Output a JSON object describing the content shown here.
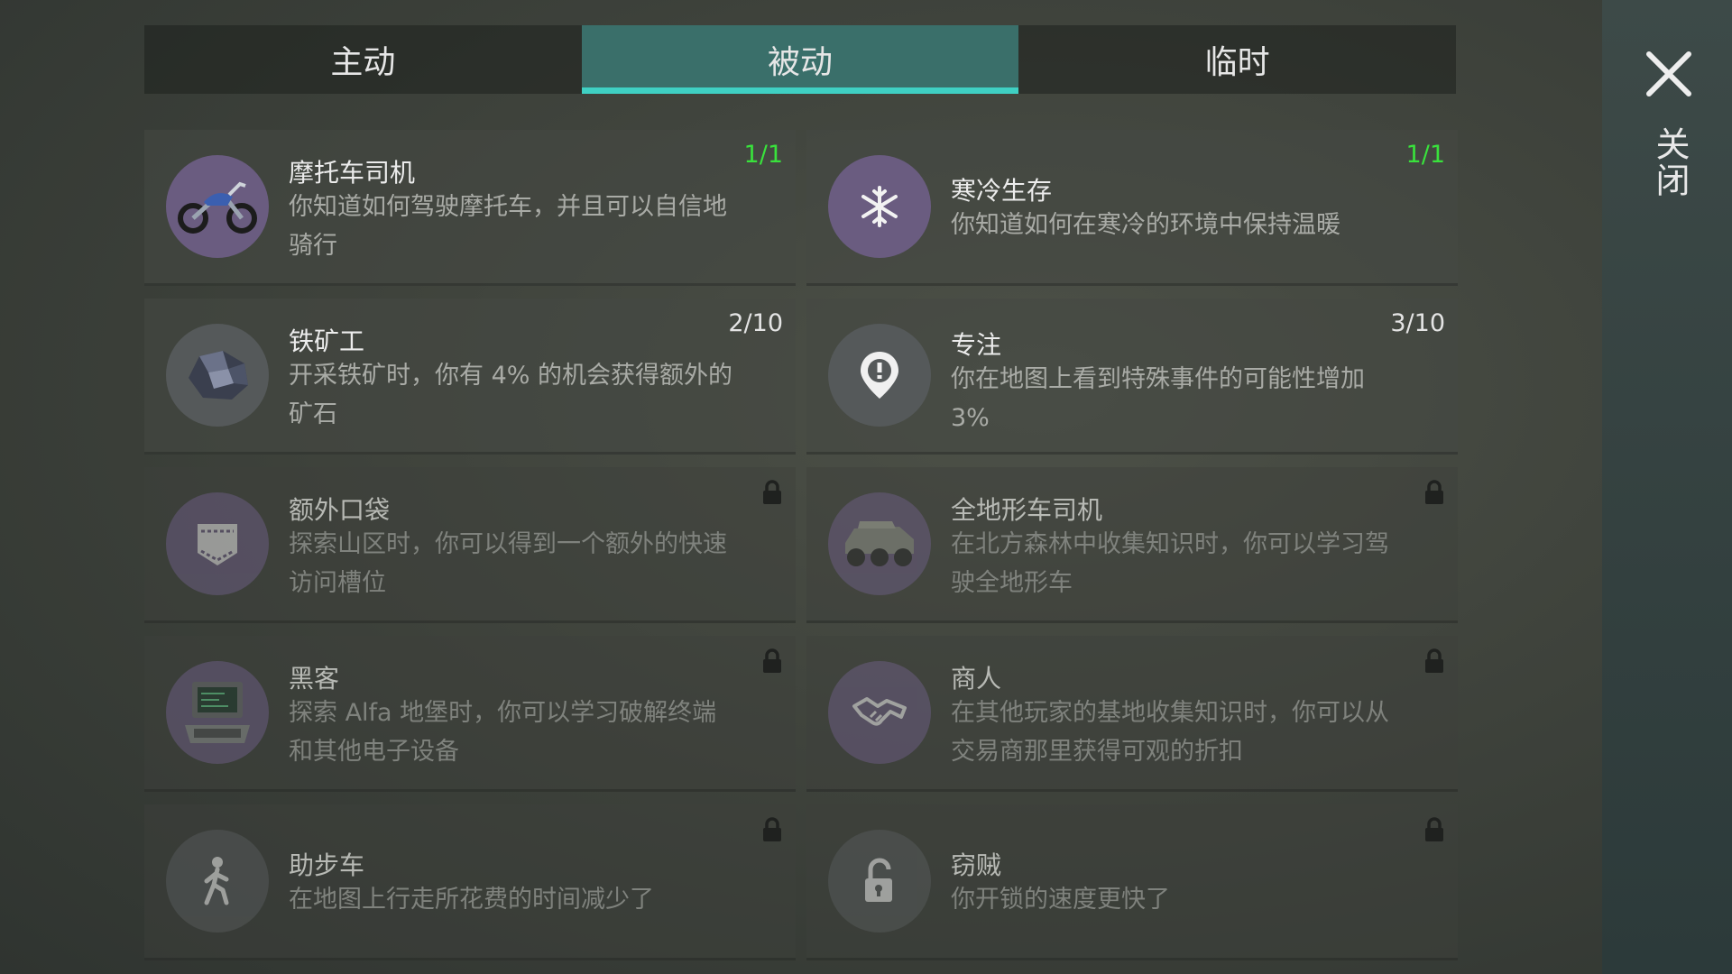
{
  "tabs": [
    {
      "label": "主动",
      "active": false
    },
    {
      "label": "被动",
      "active": true
    },
    {
      "label": "临时",
      "active": false
    }
  ],
  "close_label": "关闭",
  "colors": {
    "accent": "#3fd0c3",
    "active_tab": "#3a6f6a",
    "counter_full": "#39e23c",
    "purple_icon": "#6a5c80",
    "grey_icon": "#55595a"
  },
  "skills": [
    {
      "title": "摩托车司机",
      "desc": "你知道如何驾驶摩托车，并且可以自信地骑行",
      "counter": "1/1",
      "state": "full",
      "icon": "motorcycle-icon"
    },
    {
      "title": "寒冷生存",
      "desc": "你知道如何在寒冷的环境中保持温暖",
      "counter": "1/1",
      "state": "full",
      "icon": "snowflake-icon"
    },
    {
      "title": "铁矿工",
      "desc": "开采铁矿时，你有 4% 的机会获得额外的矿石",
      "counter": "2/10",
      "state": "partial",
      "icon": "iron-ore-icon"
    },
    {
      "title": "专注",
      "desc": "你在地图上看到特殊事件的可能性增加3%",
      "counter": "3/10",
      "state": "partial",
      "icon": "map-pin-alert-icon"
    },
    {
      "title": "额外口袋",
      "desc": "探索山区时，你可以得到一个额外的快速访问槽位",
      "counter": "",
      "state": "locked",
      "icon": "pocket-icon"
    },
    {
      "title": "全地形车司机",
      "desc": "在北方森林中收集知识时，你可以学习驾驶全地形车",
      "counter": "",
      "state": "locked",
      "icon": "atv-icon"
    },
    {
      "title": "黑客",
      "desc": "探索 Alfa 地堡时，你可以学习破解终端和其他电子设备",
      "counter": "",
      "state": "locked",
      "icon": "computer-terminal-icon"
    },
    {
      "title": "商人",
      "desc": "在其他玩家的基地收集知识时，你可以从交易商那里获得可观的折扣",
      "counter": "",
      "state": "locked",
      "icon": "handshake-icon"
    },
    {
      "title": "助步车",
      "desc": "在地图上行走所花费的时间减少了",
      "counter": "",
      "state": "locked",
      "icon": "walking-person-icon"
    },
    {
      "title": "窃贼",
      "desc": "你开锁的速度更快了",
      "counter": "",
      "state": "locked",
      "icon": "unlocked-padlock-icon"
    }
  ]
}
